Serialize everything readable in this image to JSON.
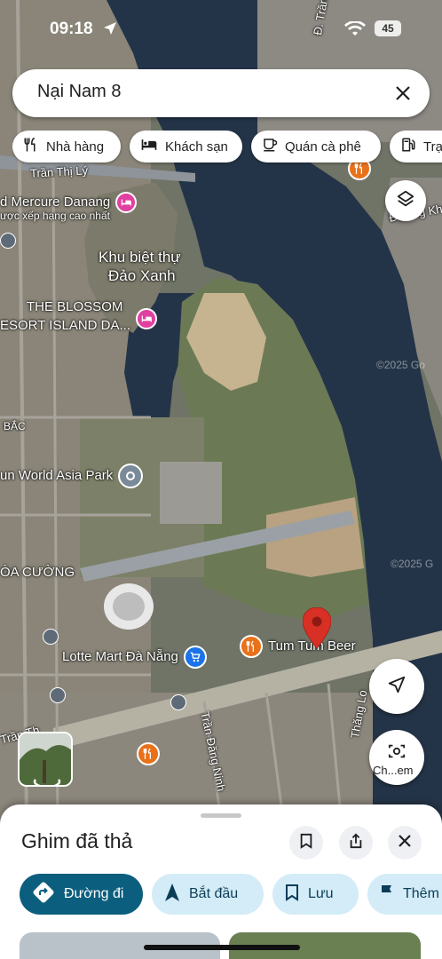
{
  "status_bar": {
    "time": "09:18",
    "battery": "45"
  },
  "search": {
    "query": "Nại Nam 8"
  },
  "chips": [
    {
      "label": "Nhà hàng",
      "icon": "fork-knife-icon"
    },
    {
      "label": "Khách sạn",
      "icon": "bed-icon"
    },
    {
      "label": "Quán cà phê",
      "icon": "coffee-cup-icon"
    },
    {
      "label": "Trạ",
      "icon": "gas-station-icon"
    }
  ],
  "map": {
    "roads": {
      "tran_thi_ly": "Trần Thị Lý",
      "tran_hung": "Đ. Trần Hư",
      "duong_kho": "Đường Khơ",
      "tran_dang_ninh": "Trần Đăng Ninh",
      "thang_long": "Thăng Lo",
      "tran_th": "Trần Th"
    },
    "labels": {
      "mercure": "d Mercure Danang",
      "mercure_sub": "ược xếp hạng cao nhất",
      "khu_biet_thu_1": "Khu biệt thự",
      "khu_biet_thu_2": "Đảo Xanh",
      "blossom_1": "THE BLOSSOM",
      "blossom_2": "ESORT ISLAND DA...",
      "bac": "BẮC",
      "asia_park": "un World Asia Park",
      "hoa_cuong": "ÒA CƯỜNG",
      "lotte": "Lotte Mart Đà Nẵng",
      "tum_tum": "Tum Tum Beer",
      "watermark_1": "©2025 Go",
      "watermark_2": "©2025 G"
    }
  },
  "controls": {
    "layers": "layers-icon",
    "location": "navigation-arrow-icon",
    "lens_label": "Ch...em"
  },
  "sheet": {
    "title": "Ghim đã thả",
    "actions": [
      {
        "label": "Đường đi",
        "icon": "directions-icon"
      },
      {
        "label": "Bắt đầu",
        "icon": "navigation-icon"
      },
      {
        "label": "Lưu",
        "icon": "bookmark-icon"
      },
      {
        "label": "Thêm",
        "icon": "flag-icon"
      }
    ]
  },
  "colors": {
    "water": "#243448",
    "primary_action": "#0b5e7d",
    "pin": "#d93025",
    "hotel": "#e040a0",
    "food": "#e8711a",
    "shop": "#1a73e8"
  }
}
